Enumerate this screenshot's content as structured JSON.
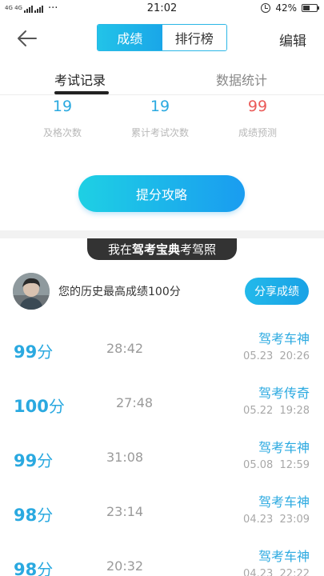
{
  "status": {
    "network": "4G 4G",
    "time": "21:02",
    "battery": "42%",
    "battery_level": 0.42,
    "dots": "···"
  },
  "nav": {
    "tab_active": "成绩",
    "tab_other": "排行榜",
    "edit": "编辑"
  },
  "tabs": {
    "records": "考试记录",
    "stats": "数据统计"
  },
  "stats": [
    {
      "value": "19",
      "label": "及格次数",
      "color": "#2aa9e0"
    },
    {
      "value": "19",
      "label": "累计考试次数",
      "color": "#2aa9e0"
    },
    {
      "value": "99",
      "label": "成绩预测",
      "color": "#ea5a58"
    }
  ],
  "cta": "提分攻略",
  "banner": {
    "pre": "我在",
    "bold": "驾考宝典",
    "post": "考驾照"
  },
  "profile": {
    "best": "您的历史最高成绩100分",
    "share": "分享成绩"
  },
  "records": [
    {
      "score": "99",
      "unit": "分",
      "duration": "28:42",
      "title": "驾考车神",
      "date": "05.23  20:26"
    },
    {
      "score": "100",
      "unit": "分",
      "duration": "27:48",
      "title": "驾考传奇",
      "date": "05.22  19:28"
    },
    {
      "score": "99",
      "unit": "分",
      "duration": "31:08",
      "title": "驾考车神",
      "date": "05.08  12:59"
    },
    {
      "score": "98",
      "unit": "分",
      "duration": "23:14",
      "title": "驾考车神",
      "date": "04.23  23:09"
    },
    {
      "score": "98",
      "unit": "分",
      "duration": "20:32",
      "title": "驾考车神",
      "date": "04.23  22:22"
    }
  ],
  "colors": {
    "accent": "#2aa9e0",
    "predict": "#ea5a58"
  }
}
